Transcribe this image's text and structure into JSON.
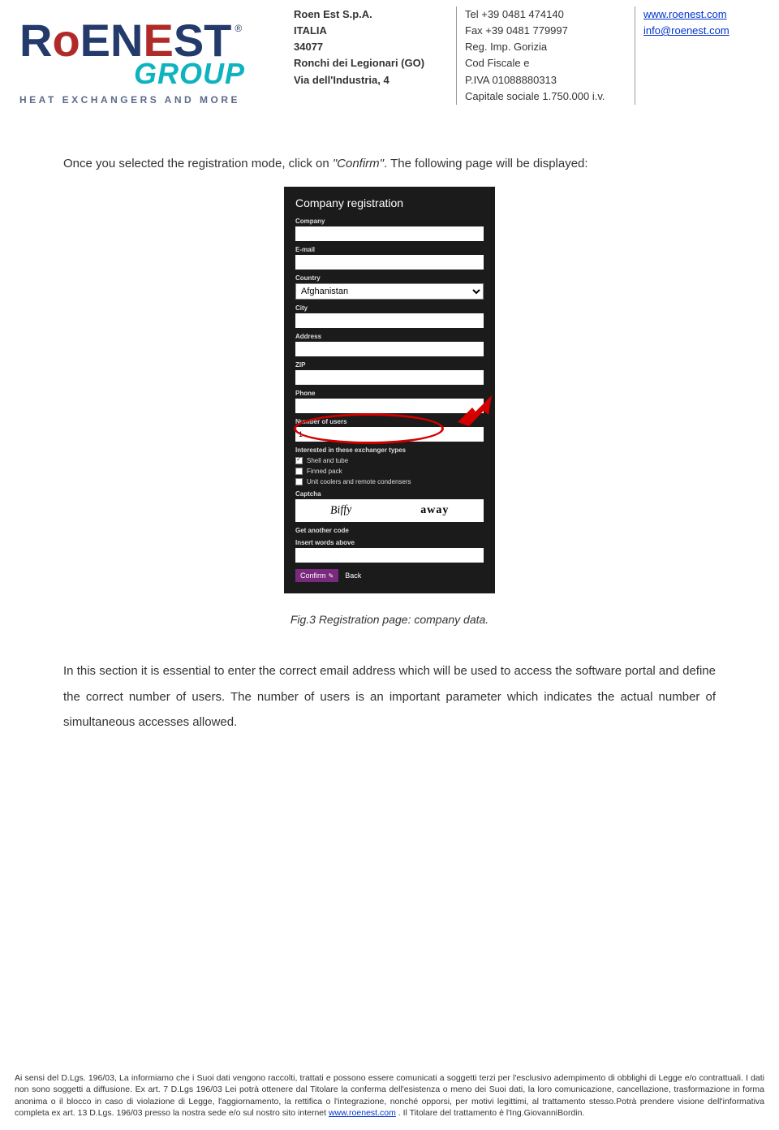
{
  "header": {
    "col1": {
      "l1": "Roen Est S.p.A.",
      "l2": "ITALIA",
      "l3": "34077",
      "l4": "Ronchi dei Legionari (GO)",
      "l5": "Via dell'Industria, 4"
    },
    "col2": {
      "l1": "Tel +39 0481 474140",
      "l2": "Fax +39 0481 779997",
      "l3": "Reg. Imp. Gorizia",
      "l4": "Cod Fiscale e",
      "l5": "P.IVA 01088880313",
      "l6": "Capitale sociale 1.750.000 i.v."
    },
    "col3": {
      "l1": "www.roenest.com",
      "l2": "info@roenest.com"
    }
  },
  "logo": {
    "brand_part1": "R",
    "brand_mid": "o",
    "brand_part2": "EN",
    "brand_mid2": "E",
    "brand_part3": "ST",
    "reg": "®",
    "group": "GROUP",
    "tagline": "HEAT EXCHANGERS AND MORE"
  },
  "body": {
    "p1a": "Once you selected the registration mode, click on ",
    "p1_confirm": "\"Confirm\"",
    "p1b": ". The following page will be displayed:"
  },
  "form": {
    "title": "Company registration",
    "labels": {
      "company": "Company",
      "email": "E-mail",
      "country": "Country",
      "city": "City",
      "address": "Address",
      "zip": "ZIP",
      "phone": "Phone",
      "num_users": "Number of users",
      "interested": "Interested in these exchanger types",
      "captcha": "Captcha",
      "get_code": "Get another code",
      "insert_words": "Insert words above"
    },
    "country_value": "Afghanistan",
    "num_users_value": "1",
    "checkboxes": {
      "shell": "Shell and tube",
      "finned": "Finned pack",
      "unit": "Unit coolers and remote condensers"
    },
    "captcha_w1": "Biffy",
    "captcha_w2": "away",
    "btn_confirm": "Confirm",
    "btn_back": "Back"
  },
  "caption": "Fig.3 Registration page: company data.",
  "body2": "In this section it is essential to enter the correct email address which will be used to access the software portal and define the correct number of users. The number of users is an important parameter which indicates the actual number of simultaneous accesses allowed.",
  "footer": {
    "text_a": "Ai sensi del D.Lgs. 196/03, La informiamo che i Suoi dati vengono raccolti, trattati e possono essere comunicati a soggetti terzi per l'esclusivo adempimento di obblighi di Legge e/o contrattuali. I dati non sono soggetti a diffusione. Ex art. 7 D.Lgs 196/03 Lei potrà ottenere dal Titolare la conferma dell'esistenza o meno dei Suoi dati, la loro comunicazione, cancellazione, trasformazione in forma anonima o il blocco in caso di violazione di Legge, l'aggiornamento, la rettifica o l'integrazione, nonché opporsi, per motivi legittimi, al trattamento stesso.Potrà prendere visione dell'informativa completa ex art. 13 D.Lgs. 196/03 presso la nostra sede e/o sul nostro sito internet ",
    "link": "www.roenest.com",
    "text_b": " . Il Titolare del trattamento è l'Ing.GiovanniBordin."
  }
}
